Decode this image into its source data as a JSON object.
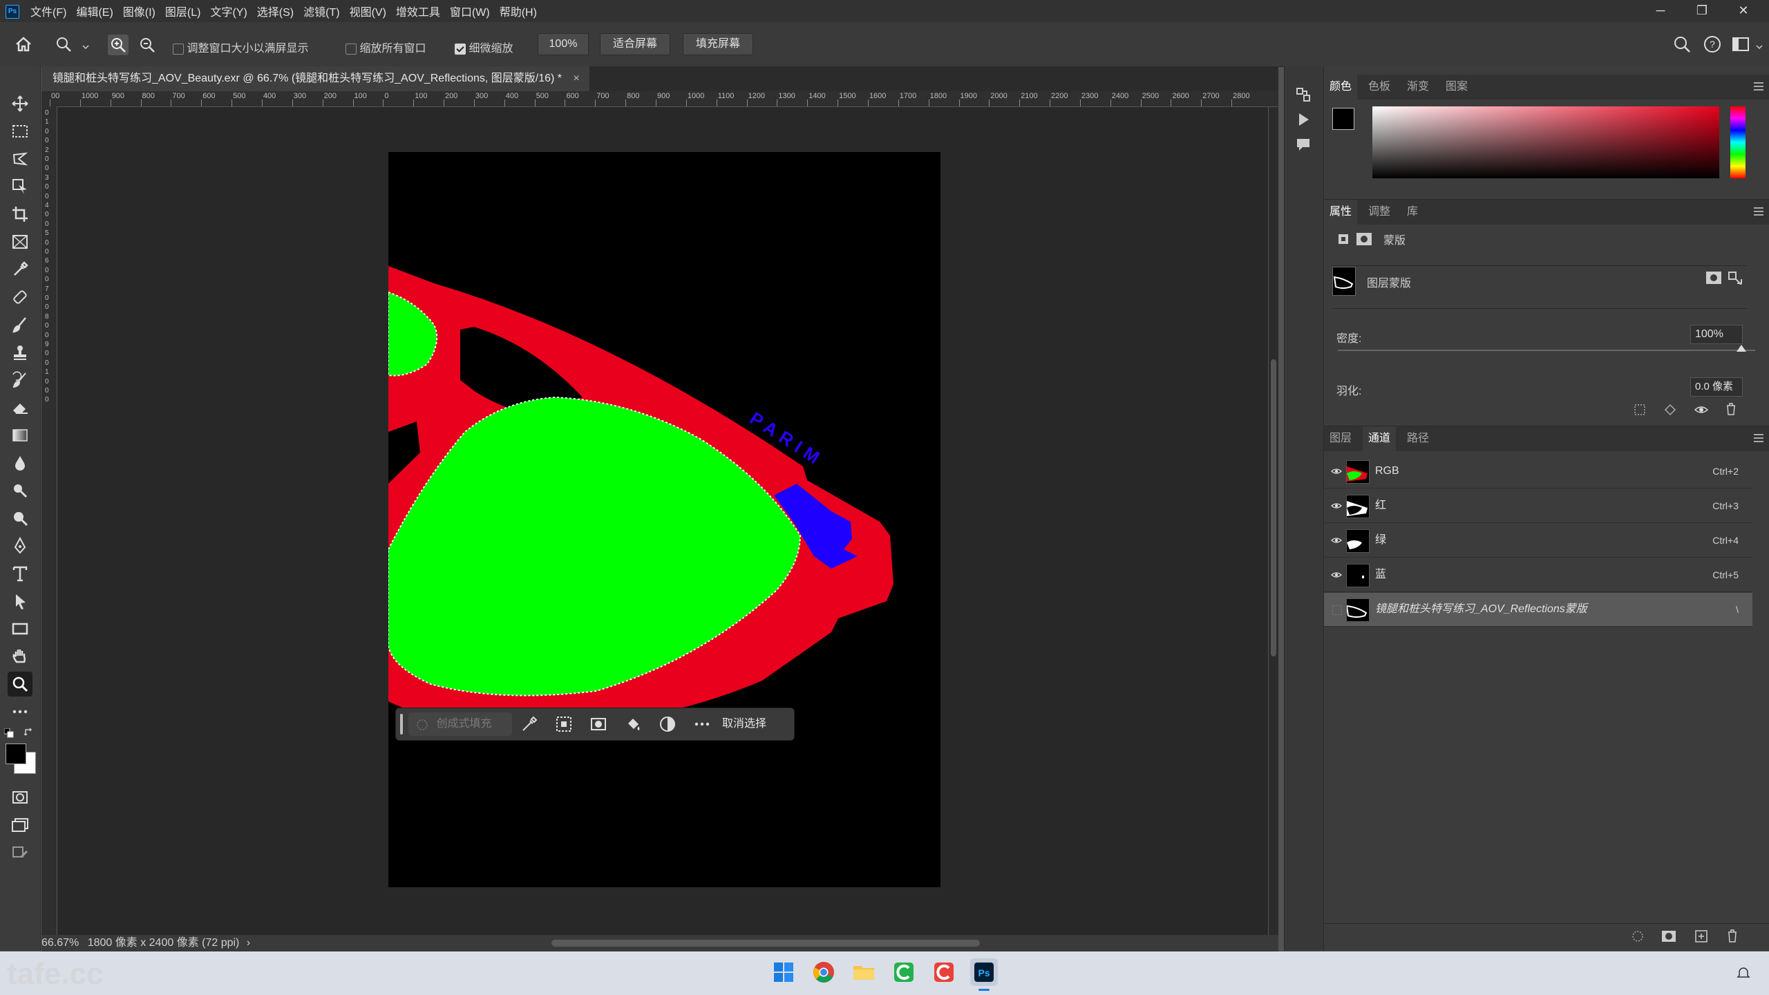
{
  "app": {
    "logo_text": "Ps"
  },
  "menu": [
    "文件(F)",
    "编辑(E)",
    "图像(I)",
    "图层(L)",
    "文字(Y)",
    "选择(S)",
    "滤镜(T)",
    "视图(V)",
    "增效工具",
    "窗口(W)",
    "帮助(H)"
  ],
  "window_controls": {
    "minimize": "─",
    "restore": "❐",
    "close": "✕"
  },
  "options": {
    "resize_windows_label": "调整窗口大小以满屏显示",
    "resize_windows_checked": false,
    "zoom_all_label": "缩放所有窗口",
    "zoom_all_checked": false,
    "scrubby_zoom_label": "细微缩放",
    "scrubby_zoom_checked": true,
    "zoom_value": "100%",
    "fit_screen_label": "适合屏幕",
    "fill_screen_label": "填充屏幕"
  },
  "document": {
    "tab_title": "镜腿和桩头特写练习_AOV_Beauty.exr @ 66.7% (镜腿和桩头特写练习_AOV_Reflections, 图层蒙版/16) *",
    "close": "×",
    "brand_text": "PARIM",
    "ruler_h_labels": [
      "00",
      "1000",
      "900",
      "800",
      "700",
      "600",
      "500",
      "400",
      "300",
      "200",
      "100",
      "0",
      "100",
      "200",
      "300",
      "400",
      "500",
      "600",
      "700",
      "800",
      "900",
      "1000",
      "1100",
      "1200",
      "1300",
      "1400",
      "1500",
      "1600",
      "1700",
      "1800",
      "1900",
      "2000",
      "2100",
      "2200",
      "2300",
      "2400",
      "2500",
      "2600",
      "2700",
      "2800"
    ],
    "ruler_v_labels": [
      "0",
      "1",
      "0",
      "0",
      "2",
      "0",
      "0",
      "3",
      "0",
      "0",
      "4",
      "0",
      "0",
      "5",
      "0",
      "0",
      "6",
      "0",
      "0",
      "7",
      "0",
      "0",
      "8",
      "0",
      "0",
      "9",
      "0",
      "0",
      "1",
      "0",
      "0",
      "0"
    ]
  },
  "context_bar": {
    "generative_fill": "创成式填充",
    "deselect": "取消选择"
  },
  "status": {
    "zoom": "66.67%",
    "doc_info": "1800 像素 x 2400 像素 (72 ppi)",
    "arrow": "›"
  },
  "color_panel": {
    "tabs": [
      "颜色",
      "色板",
      "渐变",
      "图案"
    ],
    "active_tab": "颜色"
  },
  "properties_panel": {
    "tabs": [
      "属性",
      "调整",
      "库"
    ],
    "mask_header": "蒙版",
    "layer_mask_label": "图层蒙版",
    "density_label": "密度:",
    "density_value": "100%",
    "density_fraction": 1.0,
    "feather_label": "羽化:",
    "feather_value": "0.0 像素"
  },
  "layers_panel": {
    "tabs": [
      "图层",
      "通道",
      "路径"
    ],
    "active_tab": "通道",
    "channels": [
      {
        "name": "RGB",
        "shortcut": "Ctrl+2"
      },
      {
        "name": "红",
        "shortcut": "Ctrl+3"
      },
      {
        "name": "绿",
        "shortcut": "Ctrl+4"
      },
      {
        "name": "蓝",
        "shortcut": "Ctrl+5"
      },
      {
        "name": "镜腿和桩头特写练习_AOV_Reflections蒙版",
        "shortcut": "\\"
      }
    ]
  },
  "colors": {
    "accent": "#31a8ff",
    "red_frame": "#e8001c",
    "green_lens": "#00ff00",
    "blue_pad": "#1e00ff"
  },
  "watermark": "tafe.cc"
}
